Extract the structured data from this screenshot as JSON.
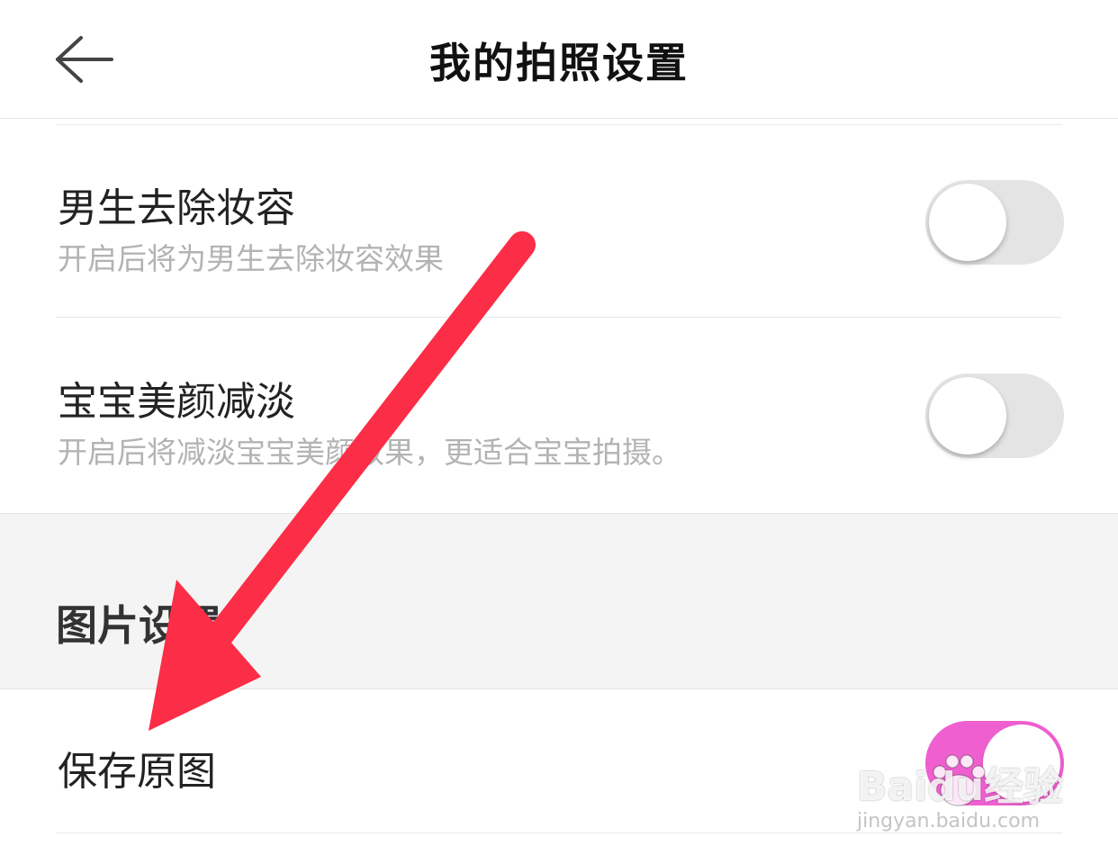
{
  "header": {
    "title": "我的拍照设置",
    "back_icon": "arrow-left-icon"
  },
  "settings": [
    {
      "title": "男生去除妆容",
      "description": "开启后将为男生去除妆容效果",
      "enabled": false
    },
    {
      "title": "宝宝美颜减淡",
      "description": "开启后将减淡宝宝美颜效果，更适合宝宝拍摄。",
      "enabled": false
    }
  ],
  "section": {
    "title": "图片设置"
  },
  "photo_settings": [
    {
      "title": "保存原图",
      "enabled": true
    }
  ],
  "annotation": {
    "type": "arrow",
    "color": "#fc2d46"
  },
  "watermark": {
    "brand": "Baidu经验",
    "url": "jingyan.baidu.com"
  },
  "colors": {
    "toggle_on": "#ef5fd0",
    "toggle_off": "#e4e4e4",
    "section_background": "#f4f4f4"
  }
}
